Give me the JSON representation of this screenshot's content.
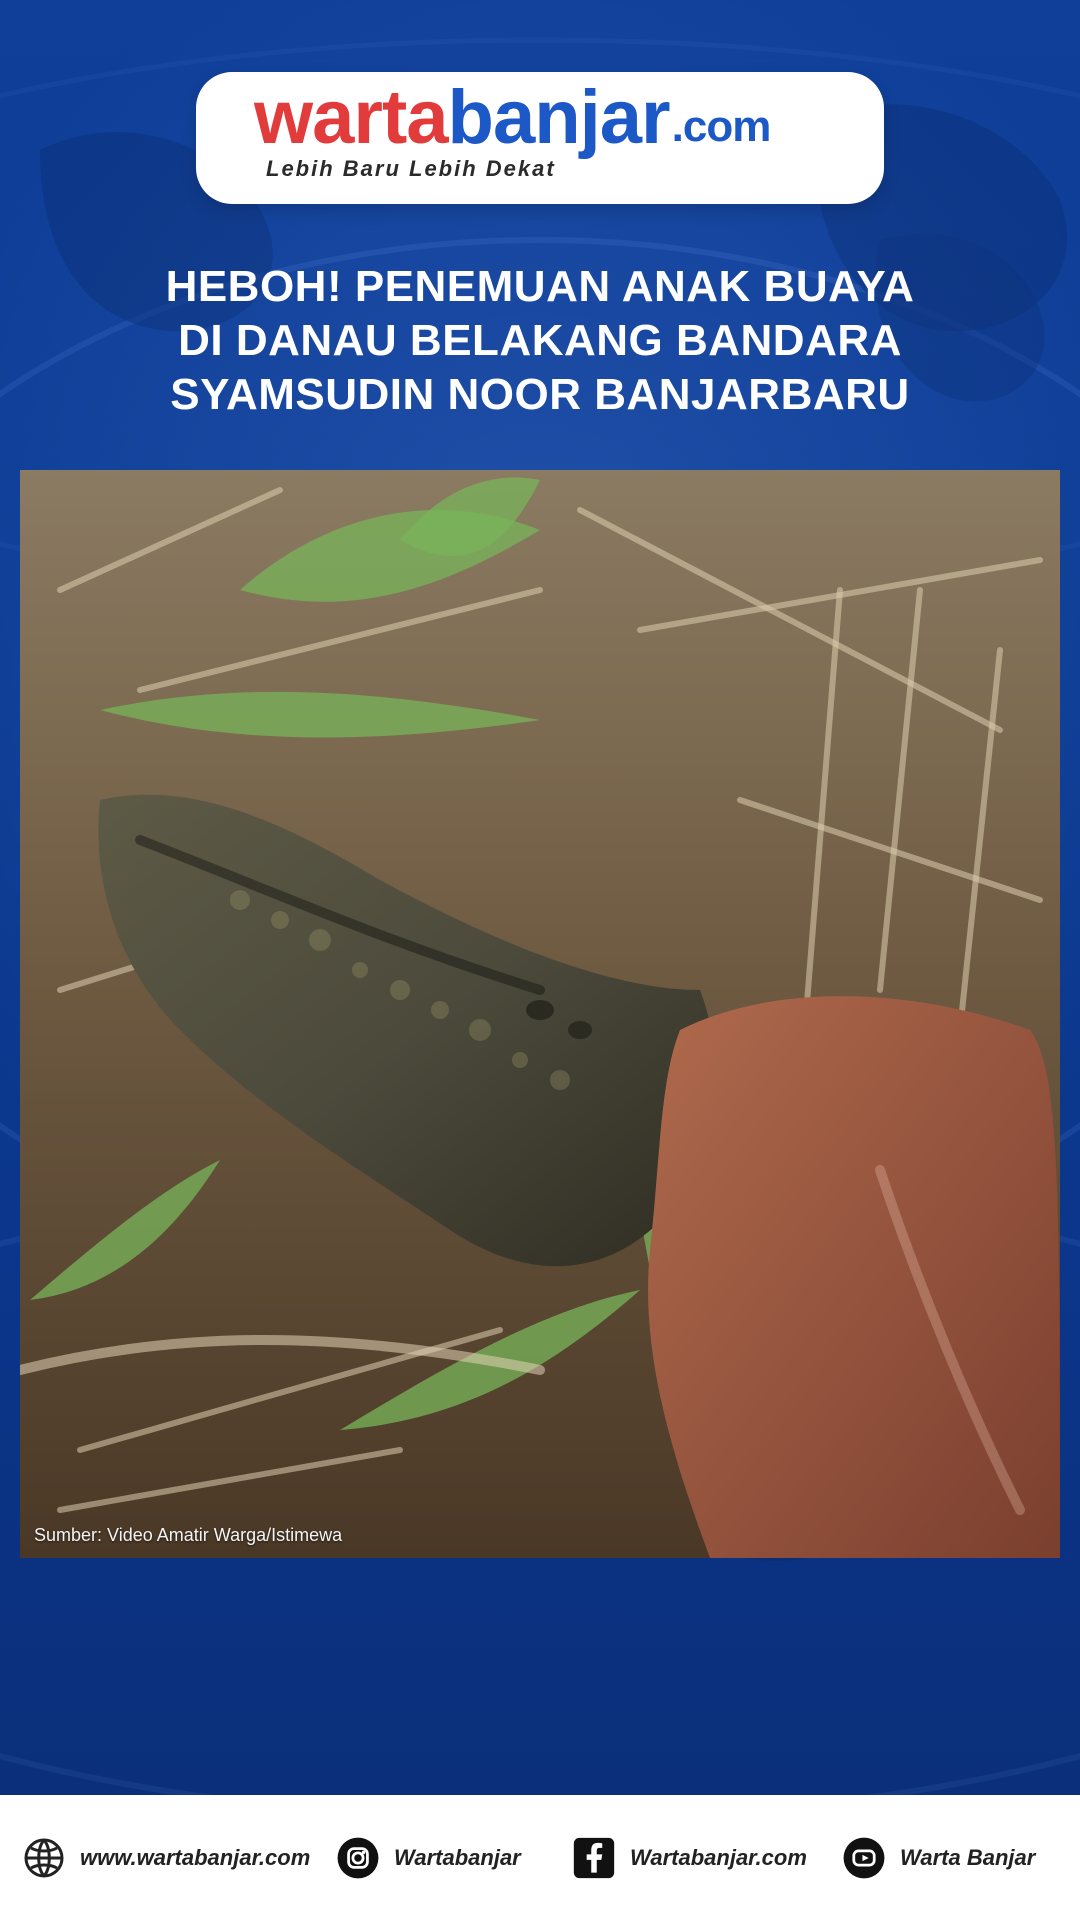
{
  "header": {
    "logo": {
      "part1": "warta",
      "part2": "banjar",
      "part3": ".com",
      "tagline": "Lebih Baru Lebih Dekat"
    }
  },
  "headline": {
    "lines": [
      "HEBOH! PENEMUAN ANAK BUAYA",
      "DI DANAU BELAKANG BANDARA",
      "SYAMSUDIN NOOR BANJARBARU"
    ]
  },
  "photo": {
    "credit": "Sumber: Video Amatir Warga/Istimewa"
  },
  "footer": {
    "items": [
      {
        "icon": "globe-icon",
        "label": "www.wartabanjar.com"
      },
      {
        "icon": "instagram-icon",
        "label": "Wartabanjar"
      },
      {
        "icon": "facebook-icon",
        "label": "Wartabanjar.com"
      },
      {
        "icon": "youtube-icon",
        "label": "Warta Banjar"
      }
    ]
  },
  "colors": {
    "background_blue": "#0f3a8f",
    "logo_red": "#e23b3b",
    "logo_blue": "#1d58c7",
    "footer_bg": "#ffffff"
  }
}
